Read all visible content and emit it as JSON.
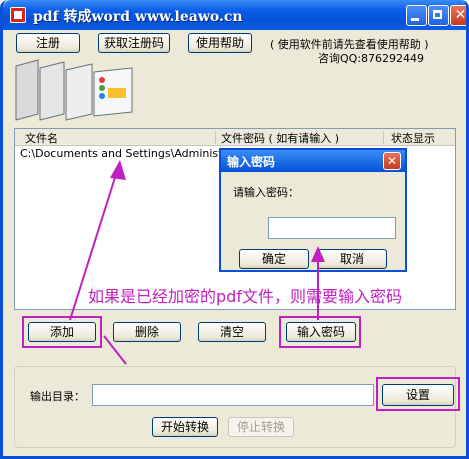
{
  "window": {
    "title": "pdf 转成word www.leawo.cn"
  },
  "titlebar_icons": [
    "minimize-icon",
    "maximize-icon",
    "close-icon"
  ],
  "toolbar": {
    "register": "注册",
    "get_code": "获取注册码",
    "help": "使用帮助",
    "note": "( 使用软件前请先查看使用帮助 )",
    "qq": "咨询QQ:876292449"
  },
  "file_list": {
    "columns": [
      "文件名",
      "文件密码 ( 如有请输入 )",
      "状态显示"
    ],
    "rows": [
      {
        "filename": "C:\\Documents and Settings\\Administr..."
      }
    ]
  },
  "actions": {
    "add": "添加",
    "delete": "删除",
    "clear": "清空",
    "enter_password": "输入密码"
  },
  "output": {
    "label": "输出目录：",
    "value": "",
    "settings": "设置",
    "start": "开始转换",
    "stop": "停止转换"
  },
  "dialog": {
    "title": "输入密码",
    "prompt": "请输入密码：",
    "ok": "确定",
    "cancel": "取消"
  },
  "annotation": {
    "text": "如果是已经加密的pdf文件，则需要输入密码",
    "color": "#c020c0"
  },
  "colors": {
    "titlebar": "#0a5ee8",
    "window_bg": "#ece9d8",
    "highlight": "#c020c0"
  }
}
